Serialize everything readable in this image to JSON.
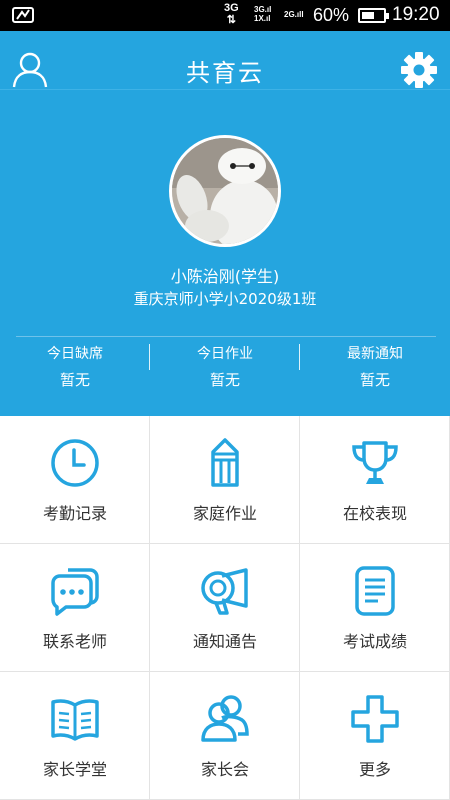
{
  "status_bar": {
    "network_primary": "3G",
    "network_secondary_top": "3G",
    "network_secondary_bottom": "1X",
    "network_tertiary": "2G",
    "battery_percent_text": "60%",
    "battery_level": 0.6,
    "time": "19:20"
  },
  "header": {
    "title": "共育云"
  },
  "profile": {
    "name": "小陈治刚(学生)",
    "class": "重庆京师小学小2020级1班"
  },
  "stats": [
    {
      "label": "今日缺席",
      "value": "暂无"
    },
    {
      "label": "今日作业",
      "value": "暂无"
    },
    {
      "label": "最新通知",
      "value": "暂无"
    }
  ],
  "menu": [
    {
      "label": "考勤记录",
      "icon": "clock-icon"
    },
    {
      "label": "家庭作业",
      "icon": "pencil-icon"
    },
    {
      "label": "在校表现",
      "icon": "trophy-icon"
    },
    {
      "label": "联系老师",
      "icon": "chat-icon"
    },
    {
      "label": "通知通告",
      "icon": "megaphone-icon"
    },
    {
      "label": "考试成绩",
      "icon": "document-icon"
    },
    {
      "label": "家长学堂",
      "icon": "book-icon"
    },
    {
      "label": "家长会",
      "icon": "group-icon"
    },
    {
      "label": "更多",
      "icon": "plus-icon"
    }
  ],
  "colors": {
    "header_blue": "#25a5df",
    "icon_blue": "#25a5df",
    "grid_line": "#e3e3e3"
  }
}
